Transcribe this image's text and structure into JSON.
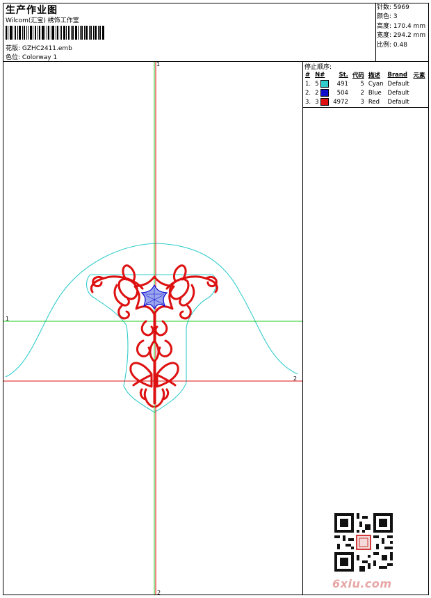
{
  "header": {
    "title": "生产作业图",
    "company": "Wilcom(汇宝) 绣饰工作室",
    "design_label": "花版:",
    "design_value": "GZHC2411.emb",
    "colorway_label": "色位:",
    "colorway_value": "Colorway 1"
  },
  "stats": {
    "stitches_label": "针数:",
    "stitches_value": "5969",
    "colors_label": "颜色:",
    "colors_value": "3",
    "height_label": "高度:",
    "height_value": "170.4 mm",
    "width_label": "宽度:",
    "width_value": "294.2 mm",
    "scale_label": "比例:",
    "scale_value": "0.48"
  },
  "sequence": {
    "title": "停止顺序:",
    "headers": [
      "#",
      "N#",
      "St.",
      "代码",
      "描述",
      "Brand",
      "元素"
    ],
    "rows": [
      {
        "idx": "1.",
        "n": "5",
        "color": "#33cccc",
        "st": "491",
        "code": "5",
        "desc": "Cyan",
        "brand": "Default"
      },
      {
        "idx": "2.",
        "n": "2",
        "color": "#1010cc",
        "st": "504",
        "code": "2",
        "desc": "Blue",
        "brand": "Default"
      },
      {
        "idx": "3.",
        "n": "3",
        "color": "#dd1111",
        "st": "4972",
        "code": "3",
        "desc": "Red",
        "brand": "Default"
      }
    ]
  },
  "axes": {
    "green_v_top": "1",
    "green_h_left": "1",
    "red_h_right": "2",
    "red_v_bottom": "2"
  },
  "colors": {
    "green": "#22cc22",
    "red": "#dd1111",
    "cyan": "#33cccc",
    "blue": "#1010cc",
    "watermark": "#e7a6a6"
  },
  "watermark": {
    "text": "6xiu.com",
    "qr_icon": "qr-code-icon"
  }
}
